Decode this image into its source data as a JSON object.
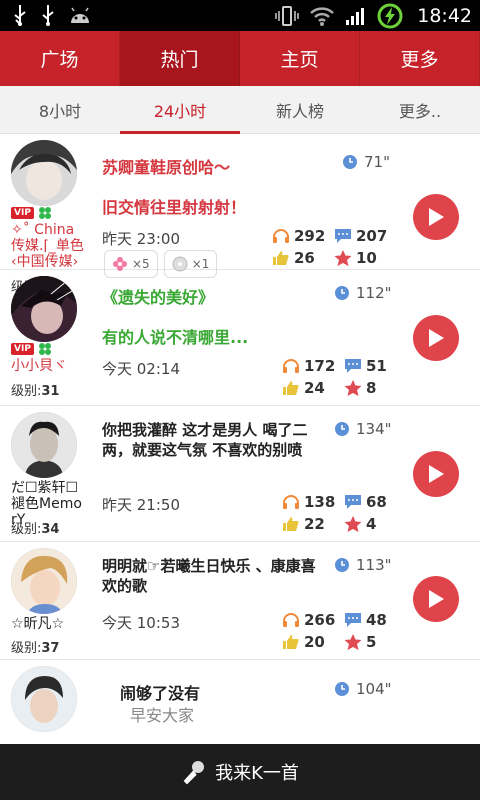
{
  "status_bar": {
    "time": "18:42"
  },
  "top_nav": {
    "tabs": [
      "广场",
      "热门",
      "主页",
      "更多"
    ],
    "active": 1
  },
  "sub_tabs": {
    "tabs": [
      "8小时",
      "24小时",
      "新人榜",
      "更多.."
    ],
    "active": 1
  },
  "items": [
    {
      "vip": "VIP",
      "user_name": "✧˚ China 传媒.⌈_单色 ‹中国传媒›",
      "level_label": "级别:",
      "level": "31",
      "title_line1": "苏卿童鞋原创哈～",
      "title_line2": "旧交情往里射射射！",
      "title_color": "red",
      "duration": "71\"",
      "time": "昨天 23:00",
      "listens": "292",
      "comments": "207",
      "likes": "26",
      "favorites": "10",
      "gifts": [
        {
          "icon": "flower-icon",
          "count": "×5"
        },
        {
          "icon": "cd-icon",
          "count": "×1"
        }
      ]
    },
    {
      "vip": "VIP",
      "user_name": "小小貝ヾ",
      "level_label": "级别:",
      "level": "31",
      "title_line1": "《遗失的美好》",
      "title_line2": "有的人说不清哪里...",
      "title_color": "green",
      "duration": "112\"",
      "time": "今天 02:14",
      "listens": "172",
      "comments": "51",
      "likes": "24",
      "favorites": "8"
    },
    {
      "user_name": "だ☐紫轩☐褪色MemorY",
      "level_label": "级别:",
      "level": "34",
      "title": "你把我灌醉 这才是男人 喝了二两，就要这气氛 不喜欢的别喷",
      "duration": "134\"",
      "time": "昨天 21:50",
      "listens": "138",
      "comments": "68",
      "likes": "22",
      "favorites": "4"
    },
    {
      "user_name": "☆昕凡☆",
      "level_label": "级别:",
      "level": "37",
      "title": "明明就☞若曦生日快乐 、康康喜欢的歌",
      "duration": "113\"",
      "time": "今天 10:53",
      "listens": "266",
      "comments": "48",
      "likes": "20",
      "favorites": "5"
    },
    {
      "title_line1": "闹够了没有",
      "title_line2": "早安大家",
      "duration": "104\""
    }
  ],
  "bottom_bar": {
    "label": "我来K一首"
  },
  "colors": {
    "brand_red": "#c6222a",
    "accent_red": "#d5373f",
    "green": "#3aa834"
  }
}
